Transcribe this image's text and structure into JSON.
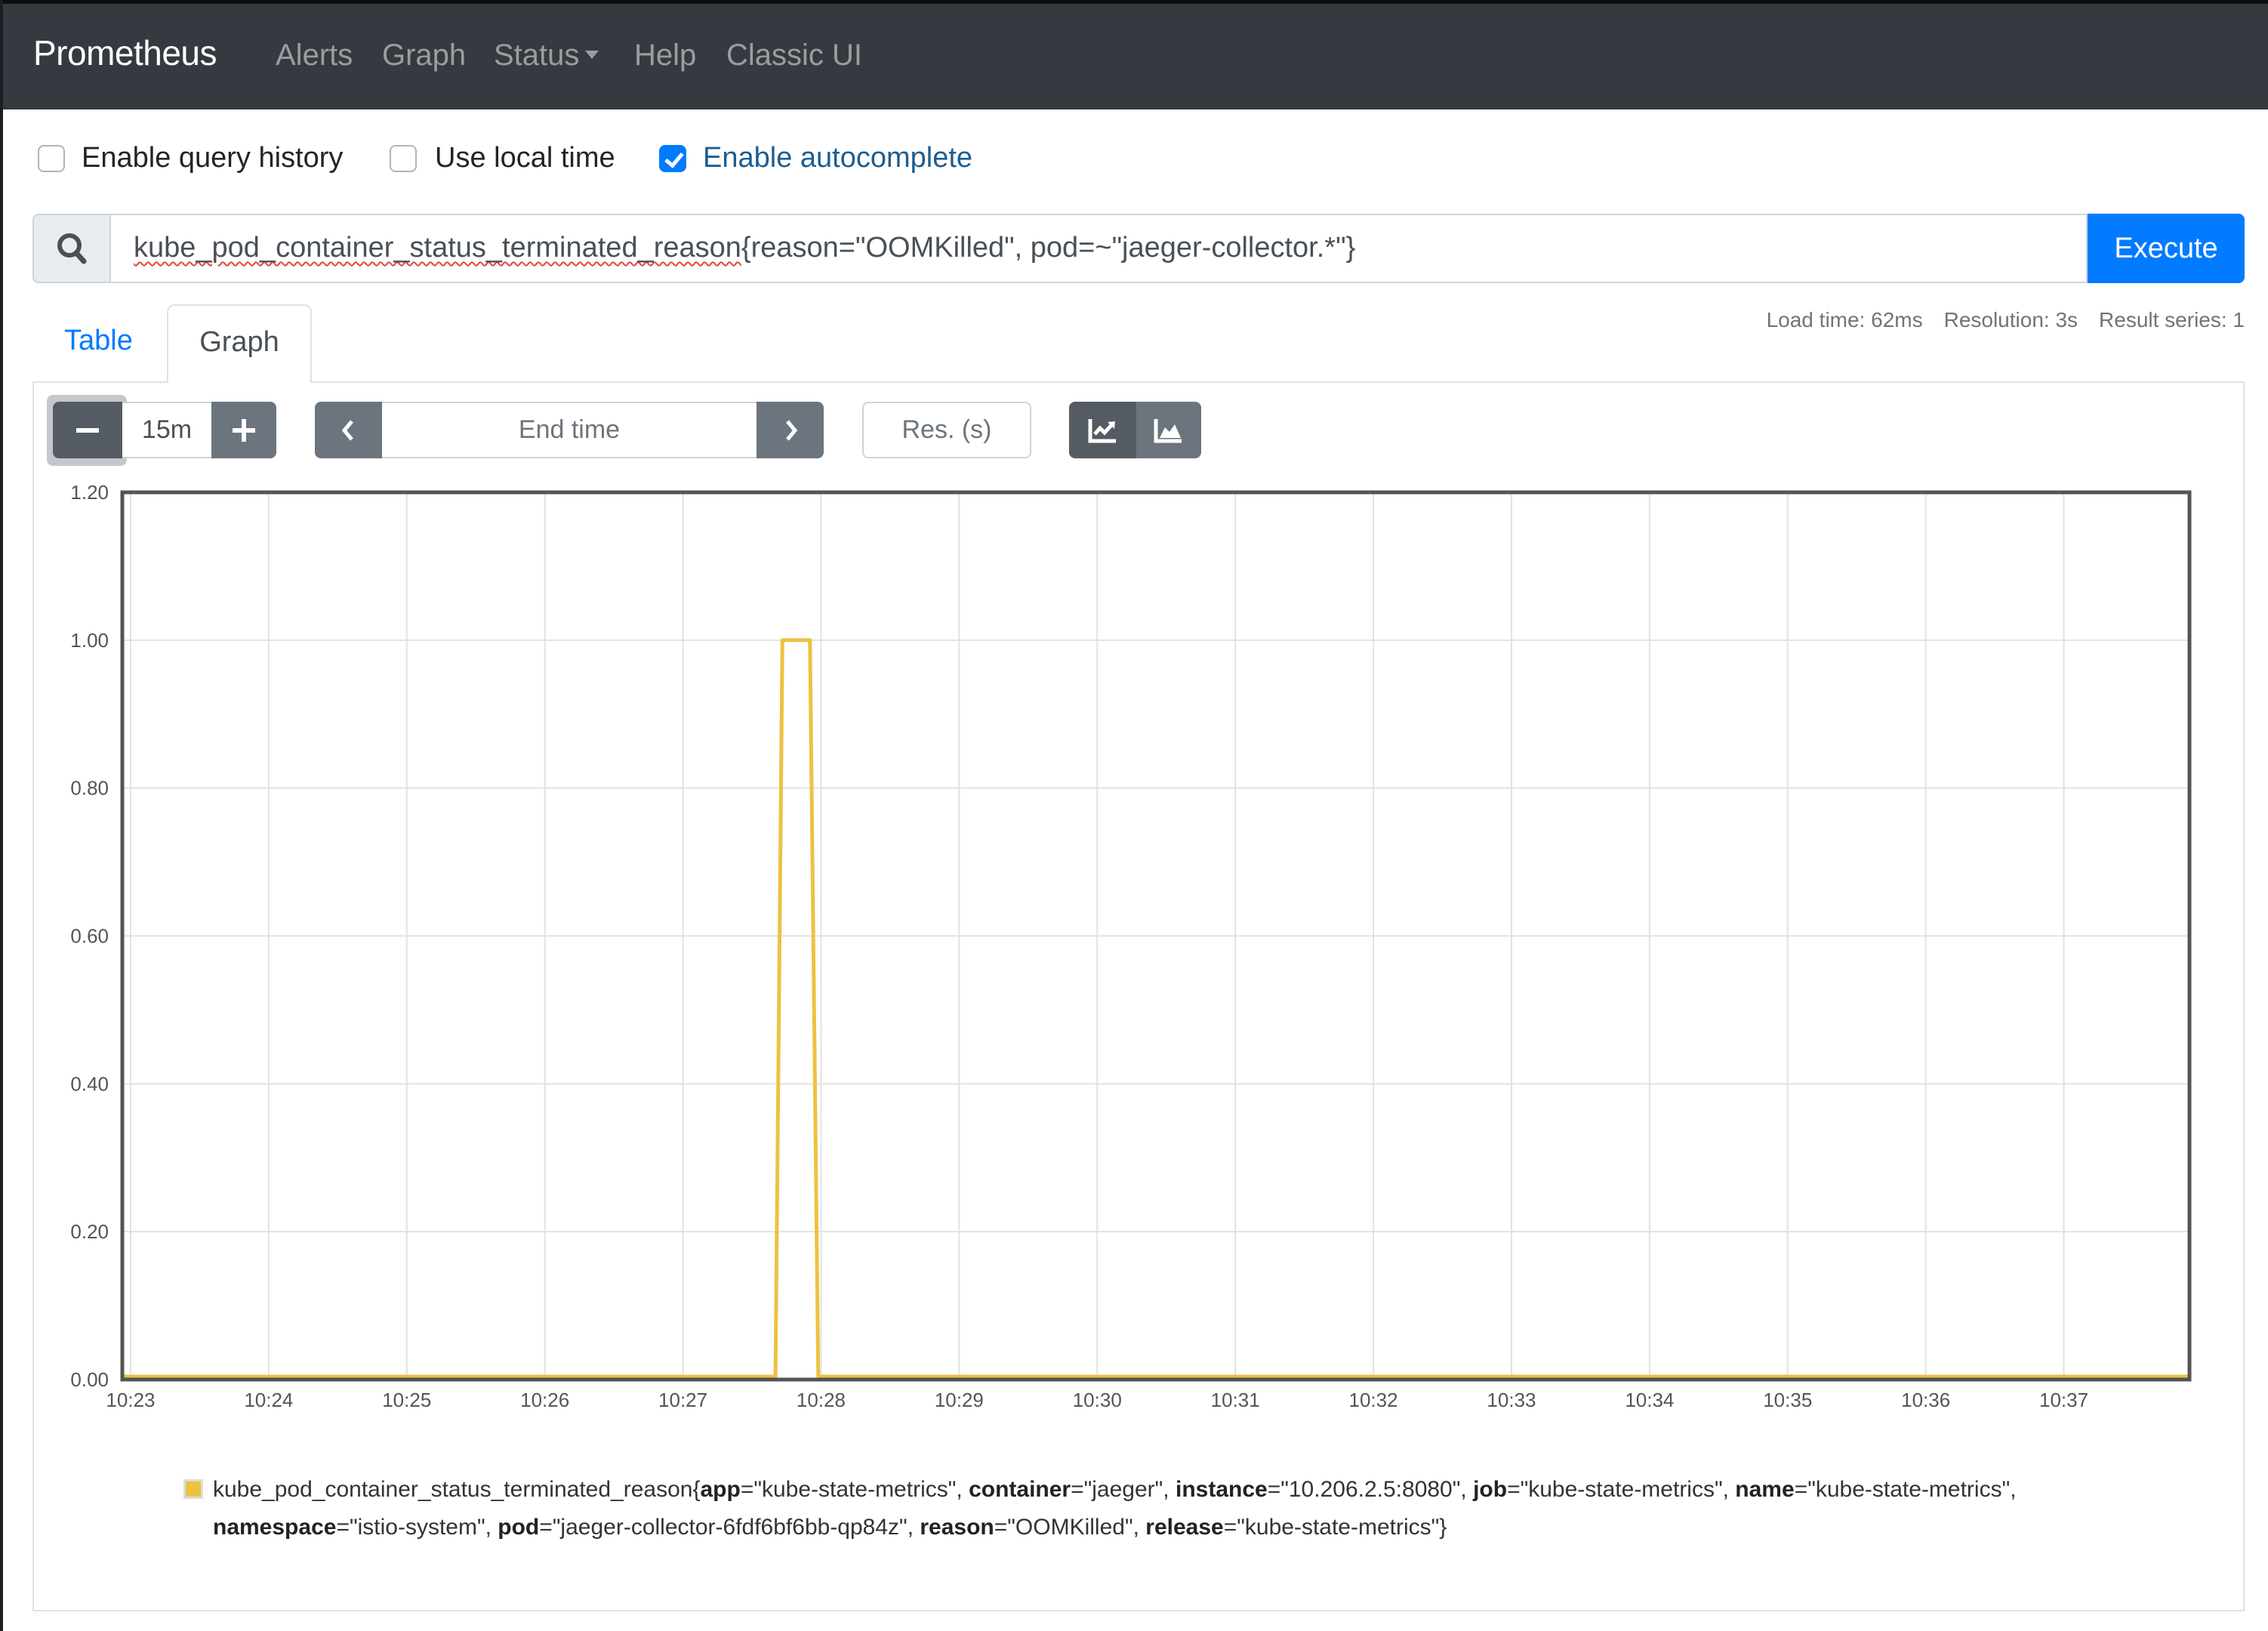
{
  "navbar": {
    "brand": "Prometheus",
    "links": [
      "Alerts",
      "Graph",
      "Status",
      "Help",
      "Classic UI"
    ]
  },
  "options": {
    "query_history": {
      "label": "Enable query history",
      "checked": false
    },
    "local_time": {
      "label": "Use local time",
      "checked": false
    },
    "autocomplete": {
      "label": "Enable autocomplete",
      "checked": true
    }
  },
  "query": {
    "metric": "kube_pod_container_status_terminated_reason",
    "selector": "{reason=\"OOMKilled\", pod=~\"jaeger-collector.*\"}",
    "execute_label": "Execute"
  },
  "stats": {
    "load_time": "Load time: 62ms",
    "resolution": "Resolution: 3s",
    "result_series": "Result series: 1"
  },
  "tabs": {
    "table": "Table",
    "graph": "Graph",
    "active": "Graph"
  },
  "controls": {
    "minus": "−",
    "range": "15m",
    "plus": "+",
    "end_time_placeholder": "End time",
    "resolution_placeholder": "Res. (s)",
    "stacked_mode": "line"
  },
  "colors": {
    "series": "#edc240",
    "accent": "#007bff",
    "navbar": "#343a40"
  },
  "chart_data": {
    "type": "line",
    "title": "",
    "xlabel": "",
    "ylabel": "",
    "ylim": [
      0,
      1.2
    ],
    "yticks": [
      "0.00",
      "0.20",
      "0.40",
      "0.60",
      "0.80",
      "1.00",
      "1.20"
    ],
    "xticks": [
      "10:23",
      "10:24",
      "10:25",
      "10:26",
      "10:27",
      "10:28",
      "10:29",
      "10:30",
      "10:31",
      "10:32",
      "10:33",
      "10:34",
      "10:35",
      "10:36",
      "10:37"
    ],
    "xlim_minutes": [
      22.94,
      37.91
    ],
    "grid": true,
    "series": [
      {
        "name": "kube_pod_container_status_terminated_reason{app=\"kube-state-metrics\", container=\"jaeger\", instance=\"10.206.2.5:8080\", job=\"kube-state-metrics\", name=\"kube-state-metrics\", namespace=\"istio-system\", pod=\"jaeger-collector-6fdf6bf6bb-qp84z\", reason=\"OOMKilled\", release=\"kube-state-metrics\"}",
        "color": "#edc240",
        "points_minutes": [
          [
            22.94,
            0
          ],
          [
            27.67,
            0
          ],
          [
            27.72,
            1
          ],
          [
            27.92,
            1
          ],
          [
            27.98,
            0
          ],
          [
            37.91,
            0
          ]
        ]
      }
    ],
    "legend": {
      "position": "bottom",
      "metric": "kube_pod_container_status_terminated_reason",
      "labels": [
        {
          "key": "app",
          "value": "\"kube-state-metrics\""
        },
        {
          "key": "container",
          "value": "\"jaeger\""
        },
        {
          "key": "instance",
          "value": "\"10.206.2.5:8080\""
        },
        {
          "key": "job",
          "value": "\"kube-state-metrics\""
        },
        {
          "key": "name",
          "value": "\"kube-state-metrics\""
        },
        {
          "key": "namespace",
          "value": "\"istio-system\""
        },
        {
          "key": "pod",
          "value": "\"jaeger-collector-6fdf6bf6bb-qp84z\""
        },
        {
          "key": "reason",
          "value": "\"OOMKilled\""
        },
        {
          "key": "release",
          "value": "\"kube-state-metrics\""
        }
      ]
    }
  }
}
